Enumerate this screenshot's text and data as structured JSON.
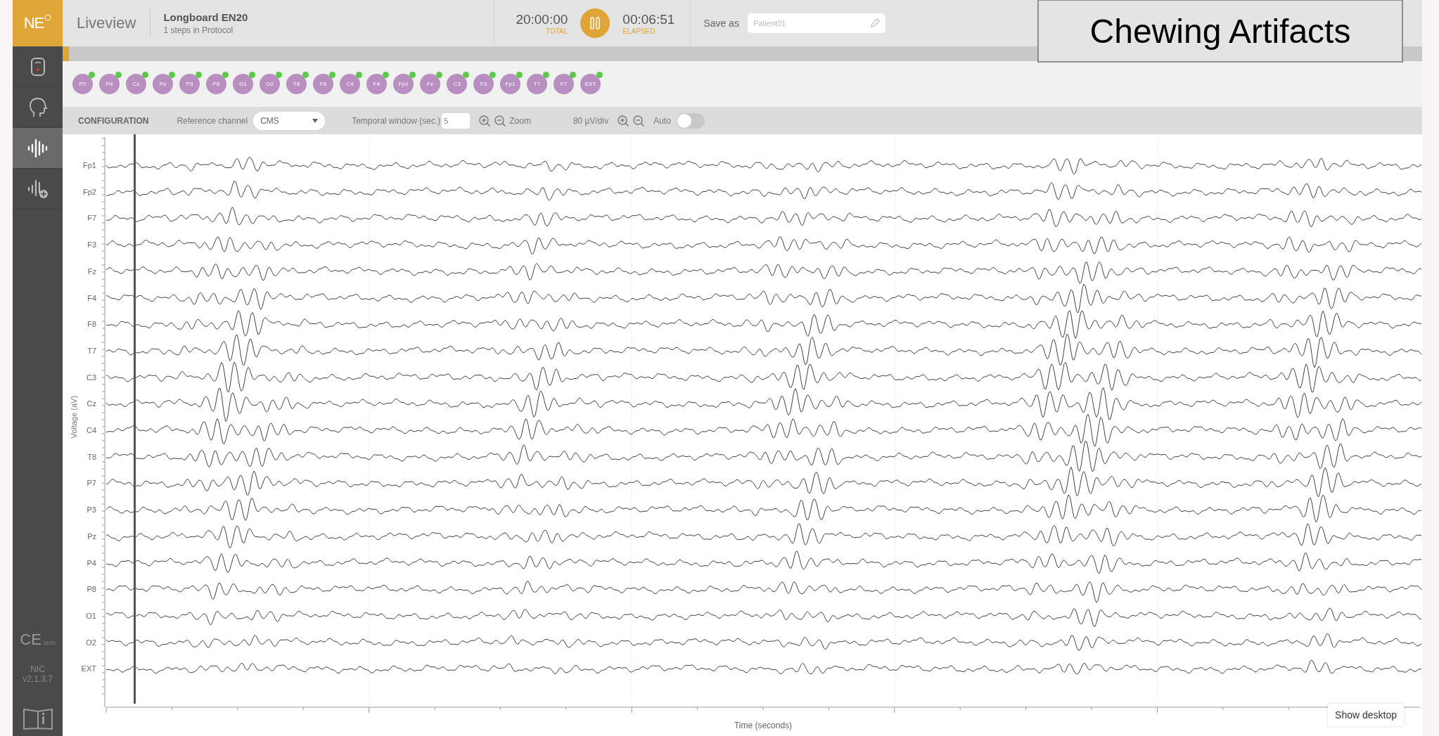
{
  "header": {
    "logo": "NE",
    "view_title": "Liveview",
    "protocol_name": "Longboard EN20",
    "protocol_steps": "1 steps in Protocol",
    "total": "20:00:00",
    "total_label": "TOTAL",
    "elapsed": "00:06:51",
    "elapsed_label": "ELAPSED",
    "save_label": "Save as",
    "save_placeholder": "Patient01"
  },
  "overlay_title": "Chewing Artifacts",
  "sidebar": {
    "items": [
      {
        "kind": "device",
        "selected": false
      },
      {
        "kind": "head",
        "selected": false
      },
      {
        "kind": "waveform",
        "selected": true
      },
      {
        "kind": "waveform-add",
        "selected": false
      }
    ],
    "ce_mark": "CE",
    "ce_number": "1639",
    "product": "NIC",
    "version": "v2.1.3.7"
  },
  "electrodes": [
    {
      "label": "P7",
      "connected": true
    },
    {
      "label": "P4",
      "connected": true
    },
    {
      "label": "Cz",
      "connected": true
    },
    {
      "label": "Pz",
      "connected": true
    },
    {
      "label": "P3",
      "connected": true
    },
    {
      "label": "P8",
      "connected": true
    },
    {
      "label": "O1",
      "connected": true
    },
    {
      "label": "O2",
      "connected": true
    },
    {
      "label": "T8",
      "connected": true
    },
    {
      "label": "F8",
      "connected": true
    },
    {
      "label": "C4",
      "connected": true
    },
    {
      "label": "F4",
      "connected": true
    },
    {
      "label": "Fp2",
      "connected": true
    },
    {
      "label": "Fz",
      "connected": true
    },
    {
      "label": "C3",
      "connected": true
    },
    {
      "label": "F3",
      "connected": true
    },
    {
      "label": "Fp1",
      "connected": true
    },
    {
      "label": "T7",
      "connected": true
    },
    {
      "label": "F7",
      "connected": true
    },
    {
      "label": "EXT",
      "connected": true
    }
  ],
  "configuration": {
    "title": "CONFIGURATION",
    "reference_label": "Reference channel",
    "reference_value": "CMS",
    "temporal_label": "Temporal window (sec.)",
    "temporal_value": "5",
    "zoom_label": "Zoom",
    "scale_label": "80 µV/div",
    "auto_label": "Auto",
    "auto_on": false
  },
  "chart": {
    "ylabel": "Voltage (aV)",
    "xlabel": "Time (seconds)",
    "channels": [
      "Fp1",
      "Fp2",
      "F7",
      "F3",
      "Fz",
      "F4",
      "F8",
      "T7",
      "C3",
      "Cz",
      "C4",
      "T8",
      "P7",
      "P3",
      "Pz",
      "P4",
      "P8",
      "O1",
      "O2",
      "EXT"
    ]
  },
  "show_desktop": "Show desktop"
}
